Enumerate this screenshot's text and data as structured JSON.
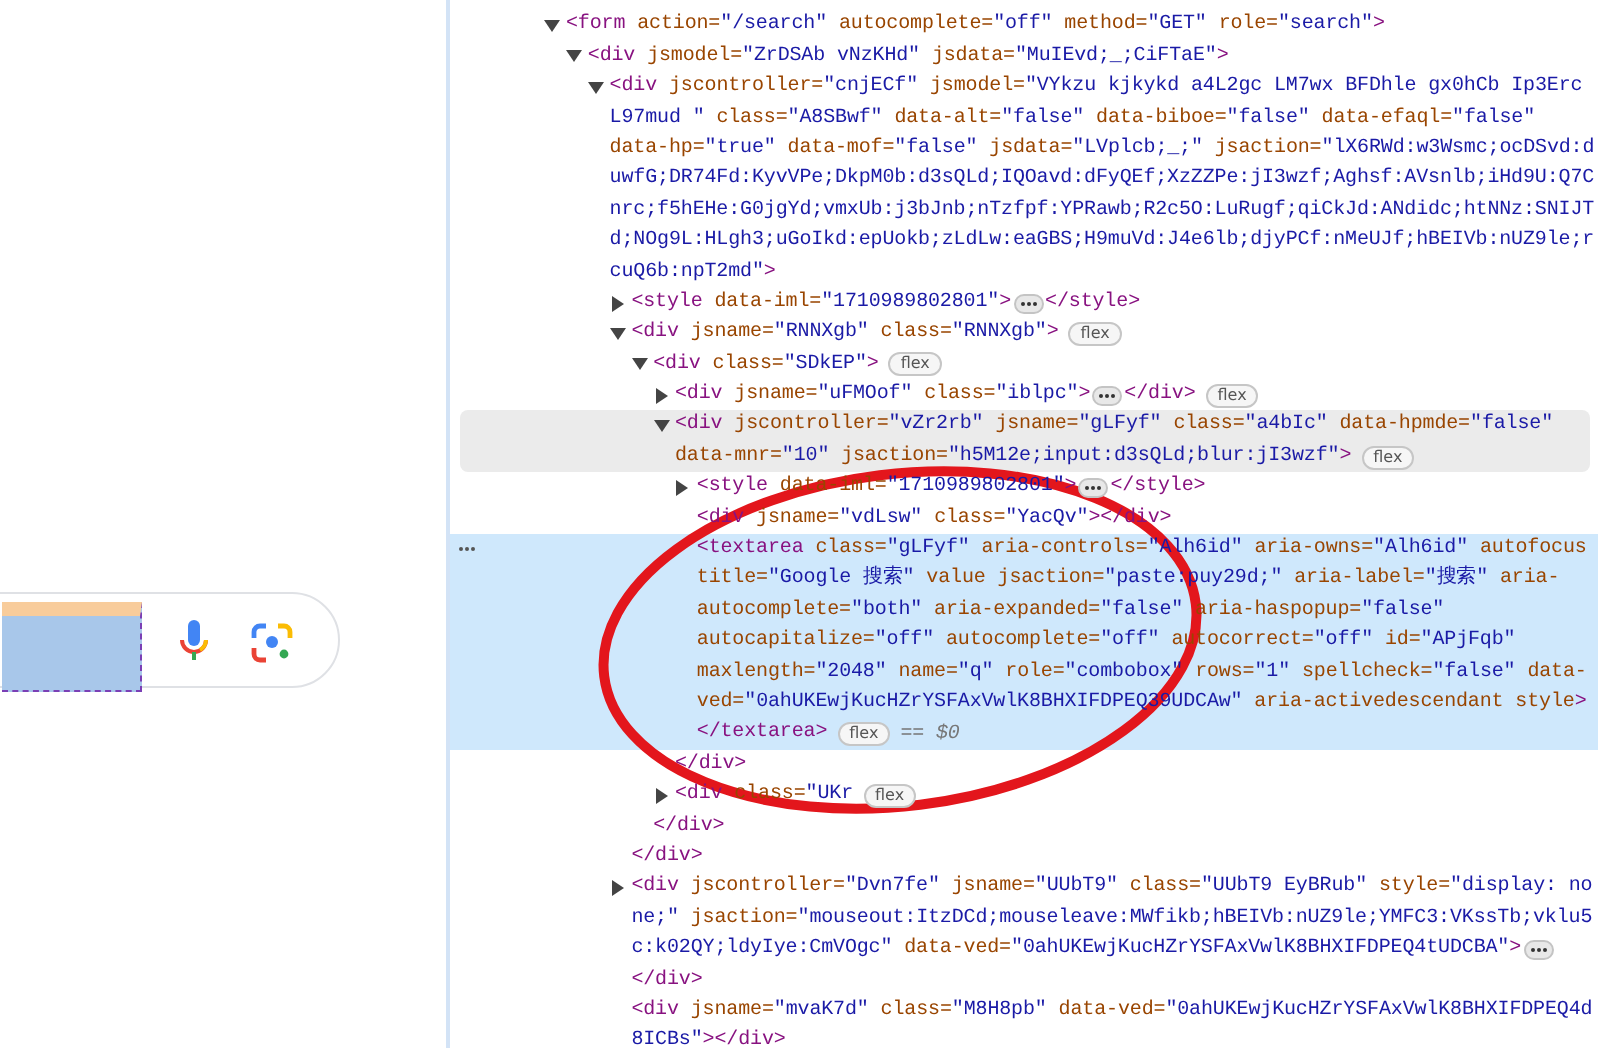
{
  "page": {
    "search_box": {
      "inspected": true
    }
  },
  "tree": [
    {
      "lines": [
        "<form action=\"/search\" autocomplete=\"off\" method=\"GET\" role=\"search\">"
      ],
      "expanded": true,
      "selected": false,
      "hovered": false,
      "children": [
        {
          "lines": [
            "<div jsmodel=\"ZrDSAb vNzKHd\" jsdata=\"MuIEvd;_;CiFTaE\">"
          ],
          "expanded": true,
          "selected": false,
          "hovered": false,
          "children": [
            {
              "lines": [
                "<div jscontroller=\"cnjECf\" jsmodel=\"VYkzu kjkykd a4L2gc LM7wx BFDhle gx0hCb Ip3Erc",
                "L97mud \" class=\"A8SBwf\" data-alt=\"false\" data-biboe=\"false\" data-efaql=\"false\"",
                "data-hp=\"true\" data-mof=\"false\" jsdata=\"LVplcb;_;\" jsaction=\"lX6RWd:w3Wsmc;ocDSvd:d",
                "uwfG;DR74Fd:KyvVPe;DkpM0b:d3sQLd;IQOavd:dFyQEf;XzZZPe:jI3wzf;Aghsf:AVsnlb;iHd9U:Q7C",
                "nrc;f5hEHe:G0jgYd;vmxUb:j3bJnb;nTzfpf:YPRawb;R2c5O:LuRugf;qiCkJd:ANdidc;htNNz:SNIJT",
                "d;NOg9L:HLgh3;uGoIkd:epUokb;zLdLw:eaGBS;H9muVd:J4e6lb;djyPCf:nMeUJf;hBEIVb:nUZ9le;r",
                "cuQ6b:npT2md\">"
              ],
              "expanded": true,
              "selected": false,
              "hovered": false,
              "children": [
                {
                  "lines": [
                    "<style data-iml=\"1710989802801\">"
                  ],
                  "expanded": false,
                  "ellipsis": true,
                  "tail": "</style>",
                  "selected": false,
                  "hovered": false
                },
                {
                  "lines": [
                    "<div jsname=\"RNNXgb\" class=\"RNNXgb\">"
                  ],
                  "badge": "flex",
                  "expanded": true,
                  "selected": false,
                  "hovered": false,
                  "close": "</div>",
                  "children": [
                    {
                      "lines": [
                        "<div class=\"SDkEP\">"
                      ],
                      "badge": "flex",
                      "expanded": true,
                      "selected": false,
                      "hovered": false,
                      "close": "</div>",
                      "children": [
                        {
                          "lines": [
                            "<div jsname=\"uFMOof\" class=\"iblpc\">"
                          ],
                          "expanded": false,
                          "ellipsis": true,
                          "tail": "</div>",
                          "badge": "flex",
                          "selected": false,
                          "hovered": false
                        },
                        {
                          "lines": [
                            "<div jscontroller=\"vZr2rb\" jsname=\"gLFyf\" class=\"a4bIc\" data-hpmde=\"false\"",
                            "data-mnr=\"10\" jsaction=\"h5M12e;input:d3sQLd;blur:jI3wzf\">"
                          ],
                          "badge": "flex",
                          "expanded": true,
                          "selected": false,
                          "hovered": true,
                          "close": "</div>",
                          "children": [
                            {
                              "lines": [
                                "<style data-iml=\"1710989802801\">"
                              ],
                              "expanded": false,
                              "ellipsis": true,
                              "tail": "</style>",
                              "selected": false,
                              "hovered": false
                            },
                            {
                              "lines": [
                                "<div jsname=\"vdLsw\" class=\"YacQv\"></div>"
                              ],
                              "selected": false,
                              "hovered": false
                            },
                            {
                              "lines": [
                                "<textarea class=\"gLFyf\" aria-controls=\"Alh6id\" aria-owns=\"Alh6id\" autofocus",
                                "title=\"Google 搜索\" value jsaction=\"paste:puy29d;\" aria-label=\"搜索\" aria-",
                                "autocomplete=\"both\" aria-expanded=\"false\" aria-haspopup=\"false\"",
                                "autocapitalize=\"off\" autocomplete=\"off\" autocorrect=\"off\" id=\"APjFqb\"",
                                "maxlength=\"2048\" name=\"q\" role=\"combobox\" rows=\"1\" spellcheck=\"false\" data-",
                                "ved=\"0ahUKEwjKucHZrYSFAxVwlK8BHXIFDPEQ39UDCAw\" aria-activedescendant style>",
                                "</textarea>"
                              ],
                              "badge": "flex",
                              "suffix": "== $0",
                              "selected": true,
                              "hovered": false
                            }
                          ]
                        },
                        {
                          "lines": [
                            "<div class=\"UKr"
                          ],
                          "expanded": false,
                          "badge": "flex",
                          "selected": false,
                          "hovered": false
                        }
                      ]
                    }
                  ]
                },
                {
                  "lines": [
                    "<div jscontroller=\"Dvn7fe\" jsname=\"UUbT9\" class=\"UUbT9 EyBRub\" style=\"display: no",
                    "ne;\" jsaction=\"mouseout:ItzDCd;mouseleave:MWfikb;hBEIVb:nUZ9le;YMFC3:VKssTb;vklu5",
                    "c:k02QY;ldyIye:CmVOgc\" data-ved=\"0ahUKEwjKucHZrYSFAxVwlK8BHXIFDPEQ4tUDCBA\">"
                  ],
                  "expanded": false,
                  "ellipsis": true,
                  "close": "</div>",
                  "selected": false,
                  "hovered": false
                },
                {
                  "lines": [
                    "<div jsname=\"mvaK7d\" class=\"M8H8pb\" data-ved=\"0ahUKEwjKucHZrYSFAxVwlK8BHXIFDPEQ4d",
                    "8ICBs\"></div>"
                  ],
                  "selected": false,
                  "hovered": false
                }
              ]
            }
          ]
        }
      ]
    }
  ],
  "annotation": {
    "kind": "ellipse"
  }
}
